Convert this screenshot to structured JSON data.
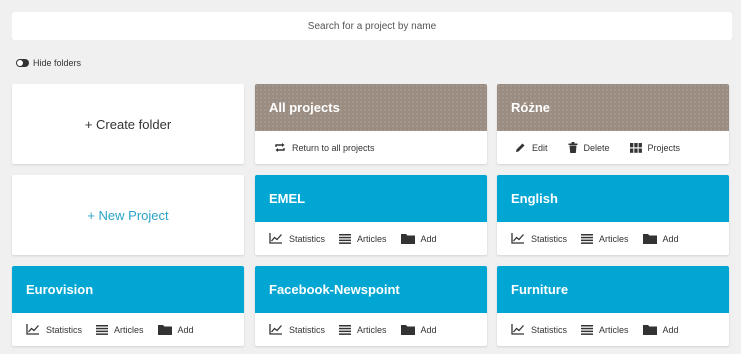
{
  "search": {
    "placeholder": "Search for a project by name"
  },
  "toggle": {
    "label": "Hide folders"
  },
  "cards": {
    "create_folder": "+ Create folder",
    "new_project": "+ New Project",
    "all_projects": {
      "title": "All projects",
      "action": "Return to all projects"
    },
    "rozne": {
      "title": "Różne",
      "edit": "Edit",
      "delete": "Delete",
      "projects": "Projects"
    },
    "emel": {
      "title": "EMEL"
    },
    "english": {
      "title": "English"
    },
    "eurovision": {
      "title": "Eurovision"
    },
    "facebook": {
      "title": "Facebook-Newspoint"
    },
    "furniture": {
      "title": "Furniture"
    }
  },
  "actions": {
    "statistics": "Statistics",
    "articles": "Articles",
    "add": "Add"
  },
  "colors": {
    "project_header": "#02a6d2",
    "folder_header": "#9b8c81",
    "link": "#2aa3c9"
  }
}
